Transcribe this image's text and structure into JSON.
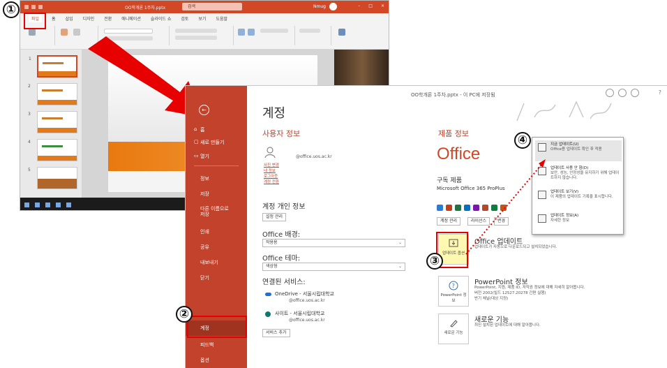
{
  "ppt": {
    "file_name": "OO학개론 1주차.pptx",
    "search": "검색",
    "user": "Nmug",
    "tabs": [
      "파일",
      "홈",
      "삽입",
      "디자인",
      "전환",
      "애니메이션",
      "슬라이드 쇼",
      "검토",
      "보기",
      "도움말"
    ],
    "slide_numbers": [
      "1",
      "2",
      "3",
      "4",
      "5"
    ]
  },
  "backstage": {
    "doc_title": "OO학개론 1주차.pptx - 이 PC에 저장됨",
    "back_glyph": "←",
    "nav": {
      "home": "홈",
      "new": "새로 만들기",
      "open": "열기",
      "info": "정보",
      "save": "저장",
      "save_as": "다른 이름으로 저장",
      "print": "인쇄",
      "share": "공유",
      "export": "내보내기",
      "close": "닫기",
      "account": "계정",
      "feedback": "피드백",
      "options": "옵션"
    },
    "page_title": "계정",
    "user_info": {
      "heading": "사용자 정보",
      "email": "@office.uos.ac.kr",
      "links": [
        "사진 변경",
        "내 정보",
        "로그아웃",
        "계정 전환"
      ]
    },
    "privacy": {
      "heading": "계정 개인 정보",
      "button": "설정 관리"
    },
    "background": {
      "label": "Office 배경:",
      "value": "작용용"
    },
    "theme": {
      "label": "Office 테마:",
      "value": "색상형"
    },
    "services": {
      "heading": "연결된 서비스:",
      "onedrive": {
        "name": "OneDrive - 서울시립대학교",
        "email": "@office.uos.ac.kr"
      },
      "sites": {
        "name": "사이트 - 서울시립대학교",
        "email": "@office.uos.ac.kr"
      },
      "add_button": "서비스 추가"
    },
    "product": {
      "heading": "제품 정보",
      "logo": "Office",
      "subscription_label": "구독 제품",
      "subscription_name": "Microsoft Office 365 ProPlus",
      "buttons": [
        "계정 관리",
        "라이선스",
        "변경"
      ],
      "icon_colors": [
        "#2b7cd3",
        "#c43e1c",
        "#217346",
        "#0072c6",
        "#7719aa",
        "#b7472a",
        "#0f7b3f",
        "#ca5010"
      ]
    },
    "updates": {
      "tile_label": "업데이트 옵션",
      "title": "Office 업데이트",
      "desc": "업데이트가 자동으로 다운로드되고 설치되었습니다."
    },
    "about": {
      "tile_label": "PowerPoint 정보",
      "title": "PowerPoint 정보",
      "desc1": "PowerPoint, 지원, 제품 ID, 저작권 정보에 대해 자세히 알아봅니다.",
      "desc2": "버전 2002(빌드 12527.20278 간편 실행)",
      "desc3": "반기 채널(대상 지정)"
    },
    "whats_new": {
      "tile_label": "새로운 기능",
      "title": "새로운 기능",
      "desc": "최신 설치된 업데이트에 대해 알아봅니다."
    },
    "menu": [
      {
        "title": "지금 업데이트(U)",
        "desc": "Office용 업데이트 확인 후 적용"
      },
      {
        "title": "업데이트 사용 안 함(D)",
        "desc": "보안, 성능, 안정성을 유지하기 위해 업데이트하지 않습니다."
      },
      {
        "title": "업데이트 보기(V)",
        "desc": "이 제품의 업데이트 기록을 표시합니다."
      },
      {
        "title": "업데이트 정보(A)",
        "desc": "자세한 정보"
      }
    ]
  },
  "markers": [
    "①",
    "②",
    "③",
    "④"
  ],
  "colors": {
    "accent": "#c2422b",
    "highlight": "#e60000",
    "ppt_title": "#d24726"
  }
}
